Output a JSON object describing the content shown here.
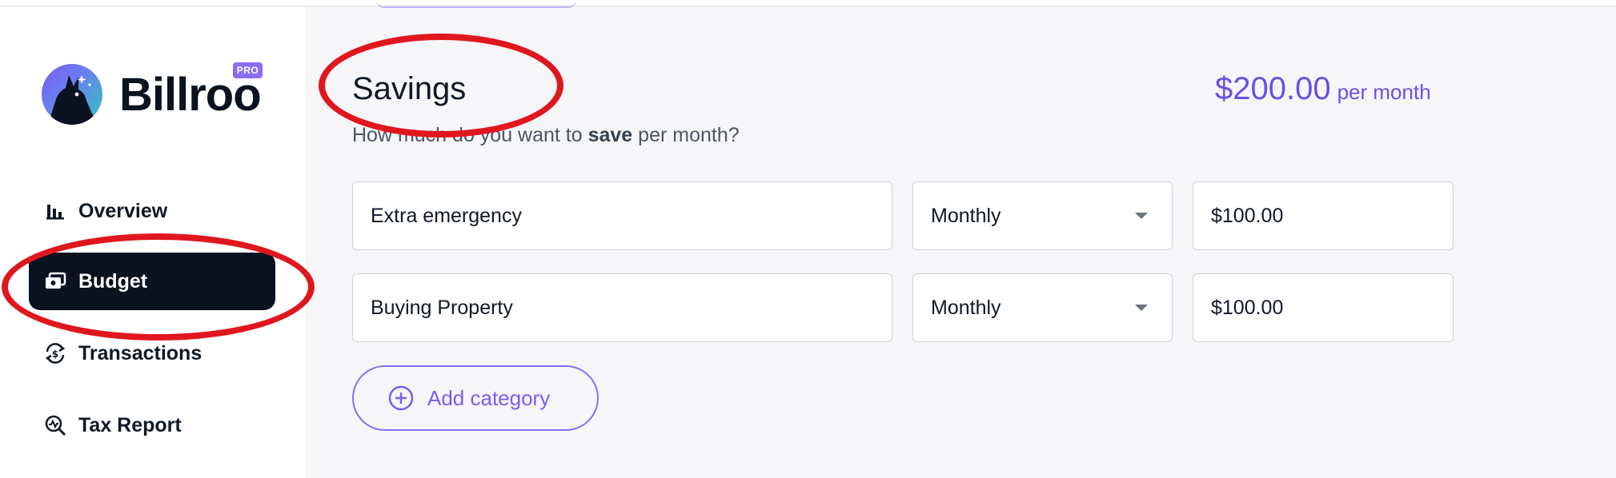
{
  "app": {
    "name": "Billroo",
    "badge": "PRO"
  },
  "nav": [
    {
      "label": "Overview",
      "icon": "bar-chart-icon",
      "active": false
    },
    {
      "label": "Budget",
      "icon": "wallet-icon",
      "active": true
    },
    {
      "label": "Transactions",
      "icon": "transactions-sync-icon",
      "active": false
    },
    {
      "label": "Tax Report",
      "icon": "tax-search-icon",
      "active": false
    }
  ],
  "section": {
    "title": "Savings",
    "subtitle_pre": "How much do you want to ",
    "subtitle_bold": "save",
    "subtitle_post": " per month?",
    "total_amount": "$200.00",
    "total_suffix": "per month"
  },
  "rows": [
    {
      "name": "Extra emergency",
      "frequency": "Monthly",
      "amount": "$100.00"
    },
    {
      "name": "Buying Property",
      "frequency": "Monthly",
      "amount": "$100.00"
    }
  ],
  "add_button": {
    "label": "Add category",
    "icon": "plus-circle-icon"
  },
  "colors": {
    "accent": "#7c5cf0",
    "active_nav_bg": "#0b1220",
    "annotation": "#e0171e"
  }
}
